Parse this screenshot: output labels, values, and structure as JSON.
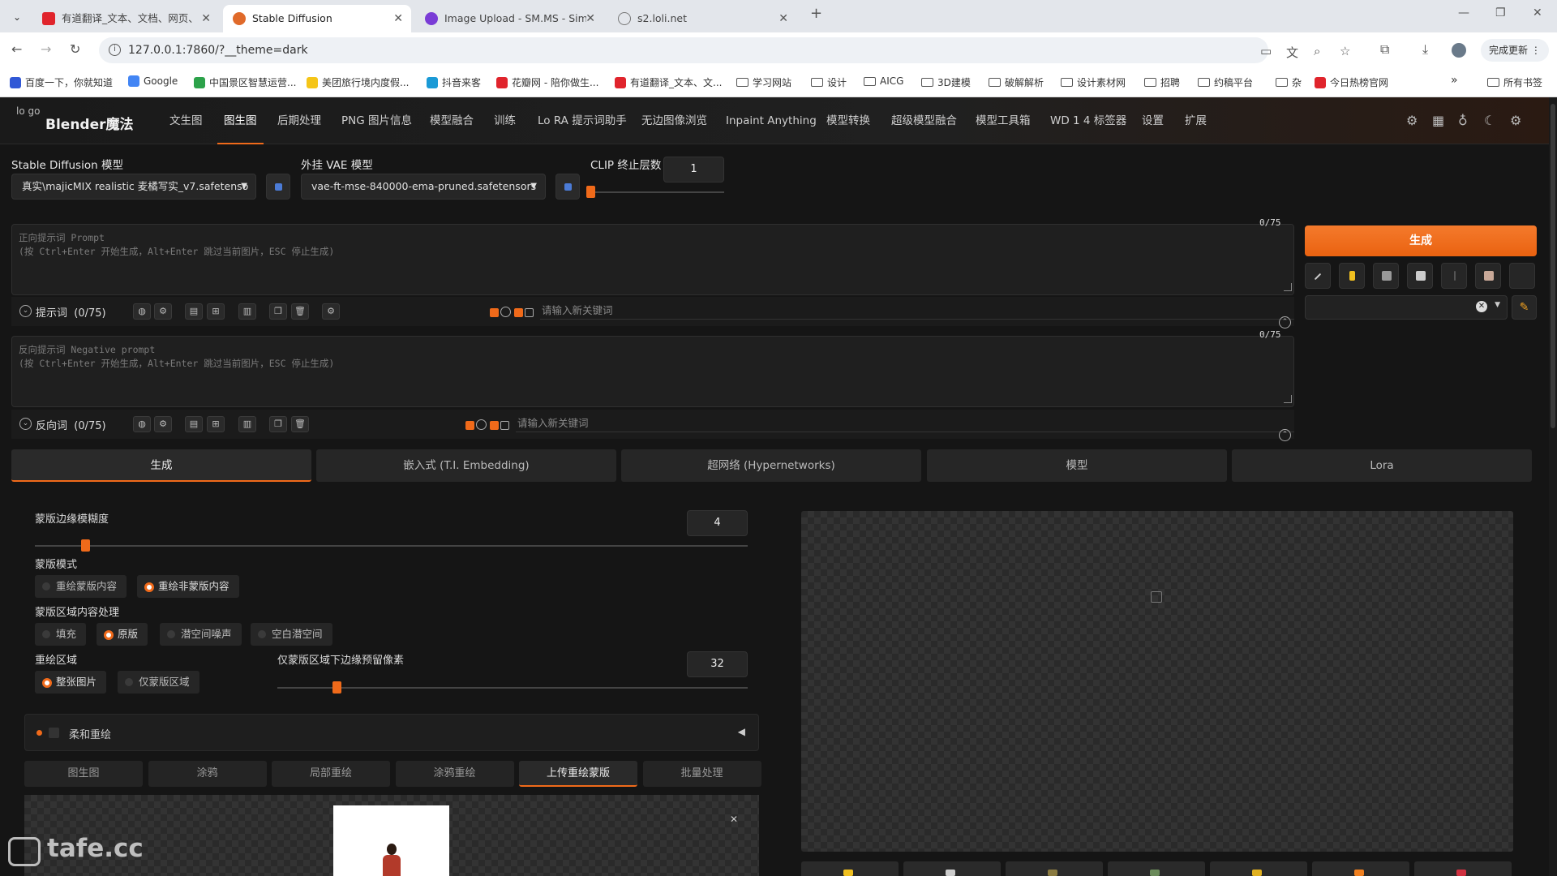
{
  "browser": {
    "tabs": [
      {
        "title": "有道翻译_文本、文档、网页、",
        "favicon_color": "#e0242c"
      },
      {
        "title": "Stable Diffusion",
        "favicon_color": "#e06a2a"
      },
      {
        "title": "Image Upload - SM.MS - Sim",
        "favicon_color": "#7a3cd6"
      },
      {
        "title": "s2.loli.net",
        "favicon_color": "#888888"
      }
    ],
    "url": "127.0.0.1:7860/?__theme=dark",
    "update_label": "完成更新",
    "bookmarks": [
      {
        "label": "百度一下，你就知道",
        "type": "site",
        "color": "#3158d6"
      },
      {
        "label": "Google",
        "type": "site",
        "color": "#4285f4"
      },
      {
        "label": "中国景区智慧运营...",
        "type": "site",
        "color": "#2ca24a"
      },
      {
        "label": "美团旅行境内度假...",
        "type": "site",
        "color": "#f5c518"
      },
      {
        "label": "抖音来客",
        "type": "site",
        "color": "#1a9ad6"
      },
      {
        "label": "花瓣网 - 陪你做生...",
        "type": "site",
        "color": "#e0242c"
      },
      {
        "label": "有道翻译_文本、文...",
        "type": "site",
        "color": "#e0242c"
      },
      {
        "label": "学习网站",
        "type": "folder"
      },
      {
        "label": "设计",
        "type": "folder"
      },
      {
        "label": "AICG",
        "type": "folder"
      },
      {
        "label": "3D建模",
        "type": "folder"
      },
      {
        "label": "破解解析",
        "type": "folder"
      },
      {
        "label": "设计素材网",
        "type": "folder"
      },
      {
        "label": "招聘",
        "type": "folder"
      },
      {
        "label": "约稿平台",
        "type": "folder"
      },
      {
        "label": "杂",
        "type": "folder"
      },
      {
        "label": "今日热榜官网",
        "type": "site",
        "color": "#e0242c"
      }
    ],
    "all_bookmarks": "所有书签"
  },
  "app": {
    "logo_alt": "lo go",
    "title": "Blender魔法",
    "nav": [
      "文生图",
      "图生图",
      "后期处理",
      "PNG 图片信息",
      "模型融合",
      "训练",
      "Lo RA 提示词助手",
      "无边图像浏览",
      "Inpaint Anything",
      "模型转换",
      "超级模型融合",
      "模型工具箱",
      "WD 1 4 标签器",
      "设置",
      "扩展"
    ],
    "active_nav": "图生图"
  },
  "models": {
    "sd_label": "Stable Diffusion 模型",
    "sd_value": "真实\\majicMIX realistic 麦橘写实_v7.safetenso",
    "vae_label": "外挂 VAE 模型",
    "vae_value": "vae-ft-mse-840000-ema-pruned.safetensors",
    "clip_label": "CLIP 终止层数",
    "clip_value": "1",
    "clip_level": 0.0
  },
  "prompt": {
    "counter": "0/75",
    "placeholder_line1": "正向提示词 Prompt",
    "placeholder_line2": "(按 Ctrl+Enter 开始生成，Alt+Enter 跳过当前图片，ESC 停止生成)",
    "toolbar_label": "提示词",
    "toolbar_count": "(0/75)",
    "keyword_placeholder": "请输入新关键词"
  },
  "negative": {
    "counter": "0/75",
    "placeholder_line1": "反向提示词 Negative prompt",
    "placeholder_line2": "(按 Ctrl+Enter 开始生成，Alt+Enter 跳过当前图片，ESC 停止生成)",
    "toolbar_label": "反向词",
    "toolbar_count": "(0/75)",
    "keyword_placeholder": "请输入新关键词"
  },
  "generate_label": "生成",
  "big_tabs": [
    "生成",
    "嵌入式 (T.I. Embedding)",
    "超网络 (Hypernetworks)",
    "模型",
    "Lora"
  ],
  "settings": {
    "mask_blur_label": "蒙版边缘模糊度",
    "mask_blur_value": "4",
    "mask_blur_level": 0.07,
    "mask_mode_label": "蒙版模式",
    "mask_mode_options": [
      "重绘蒙版内容",
      "重绘非蒙版内容"
    ],
    "mask_mode_selected": "重绘非蒙版内容",
    "masked_content_label": "蒙版区域内容处理",
    "masked_content_options": [
      "填充",
      "原版",
      "潜空间噪声",
      "空白潜空间"
    ],
    "masked_content_selected": "原版",
    "inpaint_area_label": "重绘区域",
    "inpaint_area_options": [
      "整张图片",
      "仅蒙版区域"
    ],
    "inpaint_area_selected": "整张图片",
    "padding_label": "仅蒙版区域下边缘预留像素",
    "padding_value": "32",
    "padding_level": 0.125,
    "soft_inpaint_label": "柔和重绘",
    "sub_tabs": [
      "图生图",
      "涂鸦",
      "局部重绘",
      "涂鸦重绘",
      "上传重绘蒙版",
      "批量处理"
    ],
    "sub_tab_active": "上传重绘蒙版"
  },
  "watermark": "tafe.cc"
}
